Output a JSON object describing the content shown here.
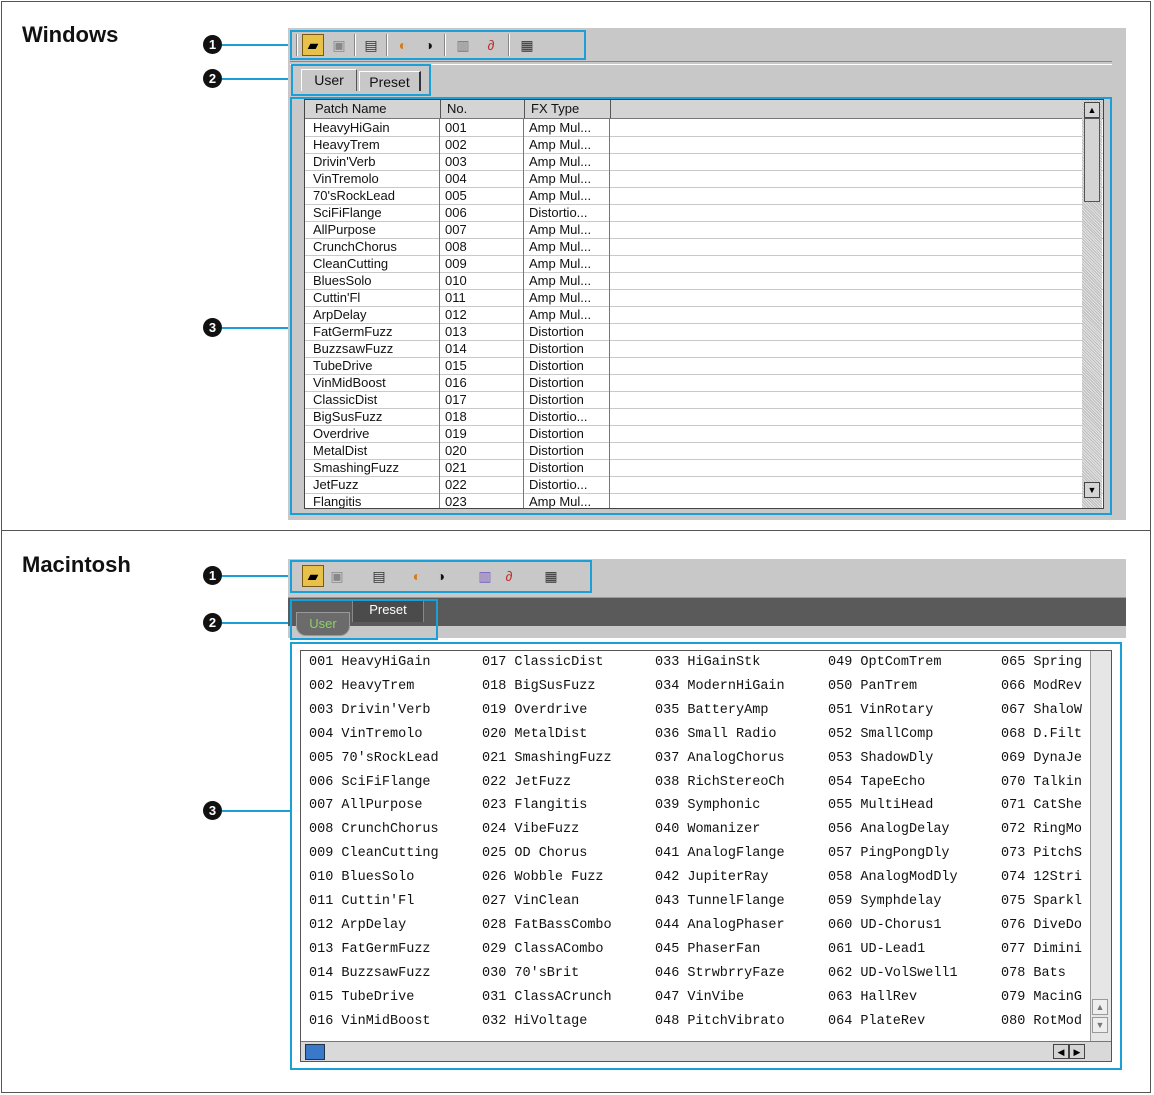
{
  "sections": {
    "windows_title": "Windows",
    "mac_title": "Macintosh"
  },
  "callouts": [
    "1",
    "2",
    "3"
  ],
  "colors": {
    "highlight": "#19a0d8",
    "toolbar": "#c8c8c8",
    "mac_tab_active": "#6aa84f"
  },
  "toolbar_icons": [
    "open-icon",
    "save-icon",
    "properties-icon",
    "receive-icon",
    "send-icon",
    "library-icon",
    "tuner-icon",
    "about-icon"
  ],
  "windows": {
    "tabs": [
      "User",
      "Preset"
    ],
    "columns": [
      "Patch Name",
      "No.",
      "FX Type"
    ],
    "rows": [
      [
        "HeavyHiGain",
        "001",
        "Amp Mul..."
      ],
      [
        "HeavyTrem",
        "002",
        "Amp Mul..."
      ],
      [
        "Drivin'Verb",
        "003",
        "Amp Mul..."
      ],
      [
        "VinTremolo",
        "004",
        "Amp Mul..."
      ],
      [
        "70'sRockLead",
        "005",
        "Amp Mul..."
      ],
      [
        "SciFiFlange",
        "006",
        "Distortio..."
      ],
      [
        "AllPurpose",
        "007",
        "Amp Mul..."
      ],
      [
        "CrunchChorus",
        "008",
        "Amp Mul..."
      ],
      [
        "CleanCutting",
        "009",
        "Amp Mul..."
      ],
      [
        "BluesSolo",
        "010",
        "Amp Mul..."
      ],
      [
        "Cuttin'Fl",
        "011",
        "Amp Mul..."
      ],
      [
        "ArpDelay",
        "012",
        "Amp Mul..."
      ],
      [
        "FatGermFuzz",
        "013",
        "Distortion"
      ],
      [
        "BuzzsawFuzz",
        "014",
        "Distortion"
      ],
      [
        "TubeDrive",
        "015",
        "Distortion"
      ],
      [
        "VinMidBoost",
        "016",
        "Distortion"
      ],
      [
        "ClassicDist",
        "017",
        "Distortion"
      ],
      [
        "BigSusFuzz",
        "018",
        "Distortio..."
      ],
      [
        "Overdrive",
        "019",
        "Distortion"
      ],
      [
        "MetalDist",
        "020",
        "Distortion"
      ],
      [
        "SmashingFuzz",
        "021",
        "Distortion"
      ],
      [
        "JetFuzz",
        "022",
        "Distortio..."
      ],
      [
        "Flangitis",
        "023",
        "Amp Mul..."
      ]
    ]
  },
  "mac": {
    "tabs": [
      "User",
      "Preset"
    ],
    "columns": [
      [
        "001 HeavyHiGain",
        "002 HeavyTrem",
        "003 Drivin'Verb",
        "004 VinTremolo",
        "005 70'sRockLead",
        "006 SciFiFlange",
        "007 AllPurpose",
        "008 CrunchChorus",
        "009 CleanCutting",
        "010 BluesSolo",
        "011 Cuttin'Fl",
        "012 ArpDelay",
        "013 FatGermFuzz",
        "014 BuzzsawFuzz",
        "015 TubeDrive",
        "016 VinMidBoost"
      ],
      [
        "017 ClassicDist",
        "018 BigSusFuzz",
        "019 Overdrive",
        "020 MetalDist",
        "021 SmashingFuzz",
        "022 JetFuzz",
        "023 Flangitis",
        "024 VibeFuzz",
        "025 OD Chorus",
        "026 Wobble Fuzz",
        "027 VinClean",
        "028 FatBassCombo",
        "029 ClassACombo",
        "030 70'sBrit",
        "031 ClassACrunch",
        "032 HiVoltage"
      ],
      [
        "033 HiGainStk",
        "034 ModernHiGain",
        "035 BatteryAmp",
        "036 Small Radio",
        "037 AnalogChorus",
        "038 RichStereoCh",
        "039 Symphonic",
        "040 Womanizer",
        "041 AnalogFlange",
        "042 JupiterRay",
        "043 TunnelFlange",
        "044 AnalogPhaser",
        "045 PhaserFan",
        "046 StrwbrryFaze",
        "047 VinVibe",
        "048 PitchVibrato"
      ],
      [
        "049 OptComTrem",
        "050 PanTrem",
        "051 VinRotary",
        "052 SmallComp",
        "053 ShadowDly",
        "054 TapeEcho",
        "055 MultiHead",
        "056 AnalogDelay",
        "057 PingPongDly",
        "058 AnalogModDly",
        "059 Symphdelay",
        "060 UD-Chorus1",
        "061 UD-Lead1",
        "062 UD-VolSwell1",
        "063 HallRev",
        "064 PlateRev"
      ],
      [
        "065 Spring",
        "066 ModRev",
        "067 ShaloW",
        "068 D.Filt",
        "069 DynaJe",
        "070 Talkin",
        "071 CatShe",
        "072 RingMo",
        "073 PitchS",
        "074 12Stri",
        "075 Sparkl",
        "076 DiveDo",
        "077 Dimini",
        "078 Bats",
        "079 MacinG",
        "080 RotMod"
      ]
    ]
  }
}
